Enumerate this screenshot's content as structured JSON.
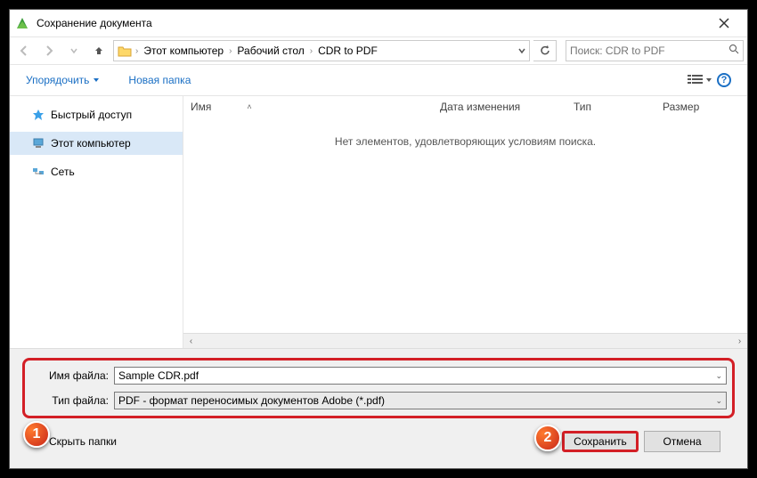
{
  "titlebar": {
    "title": "Сохранение документа"
  },
  "breadcrumb": {
    "items": [
      "Этот компьютер",
      "Рабочий стол",
      "CDR to PDF"
    ]
  },
  "search": {
    "placeholder": "Поиск: CDR to PDF"
  },
  "toolbar": {
    "organize": "Упорядочить",
    "newfolder": "Новая папка"
  },
  "sidebar": {
    "items": [
      {
        "label": "Быстрый доступ"
      },
      {
        "label": "Этот компьютер"
      },
      {
        "label": "Сеть"
      }
    ]
  },
  "columns": {
    "name": "Имя",
    "date": "Дата изменения",
    "type": "Тип",
    "size": "Размер"
  },
  "empty": "Нет элементов, удовлетворяющих условиям поиска.",
  "fields": {
    "filename_label": "Имя файла:",
    "filename_value": "Sample CDR.pdf",
    "filetype_label": "Тип файла:",
    "filetype_value": "PDF - формат переносимых документов Adobe (*.pdf)"
  },
  "footer": {
    "hide": "Скрыть папки",
    "save": "Сохранить",
    "cancel": "Отмена"
  },
  "markers": {
    "one": "1",
    "two": "2"
  }
}
